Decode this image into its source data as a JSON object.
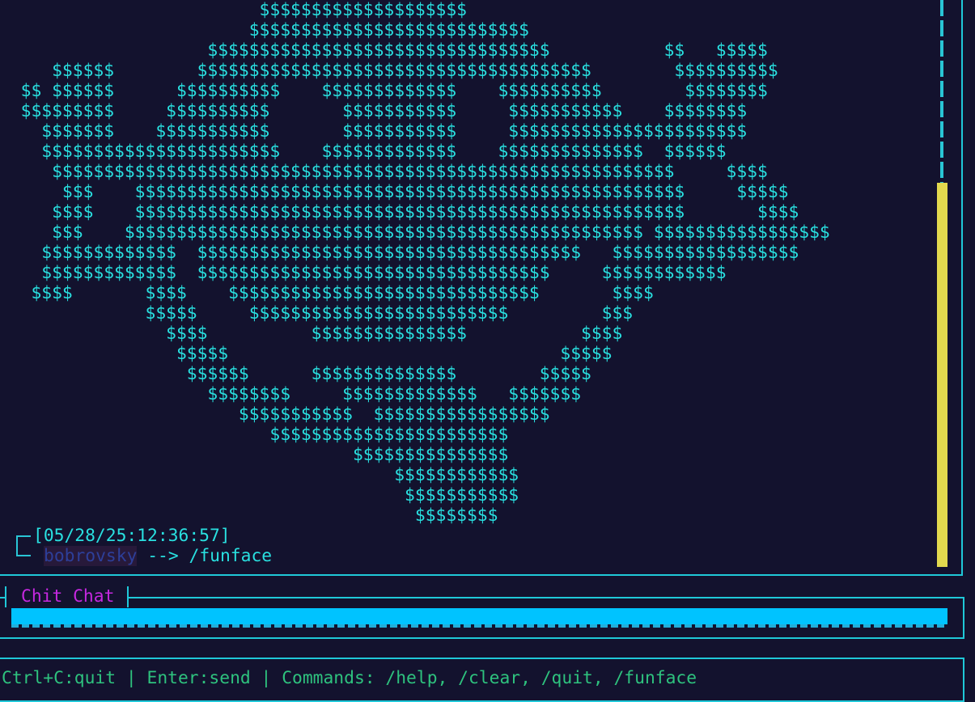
{
  "chat": {
    "ascii_art": "                         $$$$$$$$$$$$$$$$$$$$\n                        $$$$$$$$$$$$$$$$$$$$$$$$$$$\n                    $$$$$$$$$$$$$$$$$$$$$$$$$$$$$$$$$           $$   $$$$$\n     $$$$$$        $$$$$$$$$$$$$$$$$$$$$$$$$$$$$$$$$$$$$$        $$$$$$$$$$\n  $$ $$$$$$      $$$$$$$$$$    $$$$$$$$$$$$$    $$$$$$$$$$        $$$$$$$$\n  $$$$$$$$$     $$$$$$$$$$       $$$$$$$$$$$     $$$$$$$$$$$    $$$$$$$$\n    $$$$$$$    $$$$$$$$$$$       $$$$$$$$$$$     $$$$$$$$$$$$$$$$$$$$$$$\n    $$$$$$$$$$$$$$$$$$$$$$$    $$$$$$$$$$$$$    $$$$$$$$$$$$$$  $$$$$$\n     $$$$$$$$$$$$$$$$$$$$$$$$$$$$$$$$$$$$$$$$$$$$$$$$$$$$$$$$$$$$     $$$$\n      $$$    $$$$$$$$$$$$$$$$$$$$$$$$$$$$$$$$$$$$$$$$$$$$$$$$$$$$$     $$$$$\n     $$$$    $$$$$$$$$$$$$$$$$$$$$$$$$$$$$$$$$$$$$$$$$$$$$$$$$$$$$       $$$$\n     $$$    $$$$$$$$$$$$$$$$$$$$$$$$$$$$$$$$$$$$$$$$$$$$$$$$$$ $$$$$$$$$$$$$$$$$\n    $$$$$$$$$$$$$  $$$$$$$$$$$$$$$$$$$$$$$$$$$$$$$$$$$$$   $$$$$$$$$$$$$$$$$$\n    $$$$$$$$$$$$$  $$$$$$$$$$$$$$$$$$$$$$$$$$$$$$$$$$     $$$$$$$$$$$$\n   $$$$       $$$$    $$$$$$$$$$$$$$$$$$$$$$$$$$$$$$       $$$$\n              $$$$$     $$$$$$$$$$$$$$$$$$$$$$$$$         $$$\n                $$$$          $$$$$$$$$$$$$$$           $$$$\n                 $$$$$                                $$$$$\n                  $$$$$$      $$$$$$$$$$$$$$        $$$$$\n                    $$$$$$$$     $$$$$$$$$$$$$   $$$$$$$\n                       $$$$$$$$$$$  $$$$$$$$$$$$$$$$$\n                          $$$$$$$$$$$$$$$$$$$$$$$\n                                  $$$$$$$$$$$$$$$\n                                      $$$$$$$$$$$$\n                                       $$$$$$$$$$$\n                                        $$$$$$$$",
    "timestamp": "[05/28/25:12:36:57]",
    "user": "bobrovsky",
    "arrow": " --> ",
    "command": "/funface"
  },
  "input": {
    "title": "Chit Chat",
    "value": ""
  },
  "status": {
    "text": "Ctrl+C:quit | Enter:send | Commands: /help, /clear, /quit, /funface"
  },
  "colors": {
    "background": "#13122e",
    "border": "#1fc8d8",
    "art": "#29e0e0",
    "title": "#c628e0",
    "scrollbar_thumb": "#e2d94e",
    "input_bar": "#00c3ff",
    "status_text": "#2ec27e",
    "username": "#2d3f9a"
  }
}
